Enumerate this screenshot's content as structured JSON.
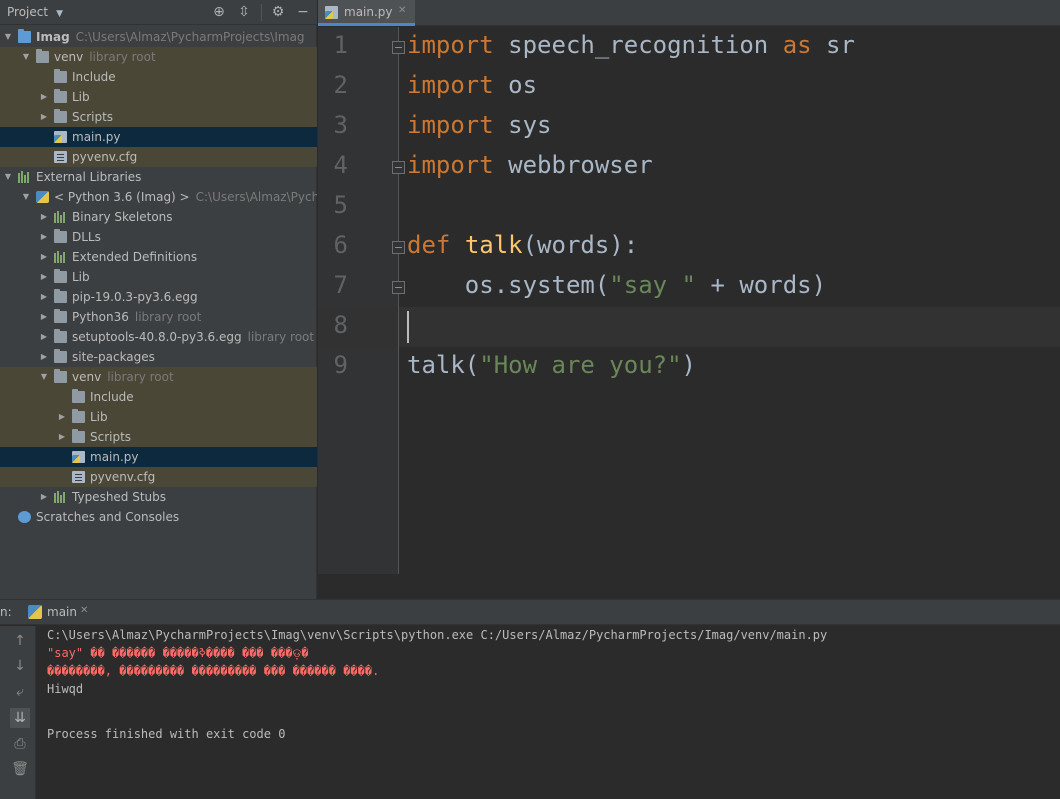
{
  "project_panel": {
    "title": "Project",
    "toolbar_icons": [
      "locate-icon",
      "collapse-icon",
      "gear-icon",
      "hide-icon"
    ],
    "tree": [
      {
        "label": "Imag",
        "hint": "C:\\Users\\Almaz\\PycharmProjects\\Imag",
        "icon": "folder-icon",
        "expanded": true
      },
      {
        "label": "venv",
        "hint": "library root",
        "icon": "folder-icon",
        "expanded": true
      },
      {
        "label": "Include",
        "icon": "folder-icon"
      },
      {
        "label": "Lib",
        "icon": "folder-icon",
        "expanded": false
      },
      {
        "label": "Scripts",
        "icon": "folder-icon",
        "expanded": false
      },
      {
        "label": "main.py",
        "icon": "python-file-icon",
        "selected": true
      },
      {
        "label": "pyvenv.cfg",
        "icon": "config-file-icon"
      },
      {
        "label": "External Libraries",
        "icon": "libraries-icon",
        "expanded": true
      },
      {
        "label": "< Python 3.6 (Imag) >",
        "hint": "C:\\Users\\Almaz\\PycharmProje",
        "icon": "python-icon",
        "expanded": true
      },
      {
        "label": "Binary Skeletons",
        "icon": "libraries-icon",
        "expanded": false
      },
      {
        "label": "DLLs",
        "icon": "folder-icon",
        "expanded": false
      },
      {
        "label": "Extended Definitions",
        "icon": "libraries-icon",
        "expanded": false
      },
      {
        "label": "Lib",
        "icon": "folder-icon",
        "expanded": false
      },
      {
        "label": "pip-19.0.3-py3.6.egg",
        "icon": "folder-icon",
        "expanded": false
      },
      {
        "label": "Python36",
        "hint": "library root",
        "icon": "folder-icon",
        "expanded": false
      },
      {
        "label": "setuptools-40.8.0-py3.6.egg",
        "hint": "library root",
        "icon": "folder-icon",
        "expanded": false
      },
      {
        "label": "site-packages",
        "icon": "folder-icon",
        "expanded": false
      },
      {
        "label": "venv",
        "hint": "library root",
        "icon": "folder-icon",
        "expanded": true
      },
      {
        "label": "Include",
        "icon": "folder-icon"
      },
      {
        "label": "Lib",
        "icon": "folder-icon",
        "expanded": false
      },
      {
        "label": "Scripts",
        "icon": "folder-icon",
        "expanded": false
      },
      {
        "label": "main.py",
        "icon": "python-file-icon",
        "selected": true
      },
      {
        "label": "pyvenv.cfg",
        "icon": "config-file-icon"
      },
      {
        "label": "Typeshed Stubs",
        "icon": "libraries-icon",
        "expanded": false
      },
      {
        "label": "Scratches and Consoles",
        "icon": "scratches-icon"
      }
    ]
  },
  "editor": {
    "tab_label": "main.py",
    "line_numbers": [
      "1",
      "2",
      "3",
      "4",
      "5",
      "6",
      "7",
      "8",
      "9"
    ],
    "code": {
      "l1_kw": "import",
      "l1_mod": " speech_recognition ",
      "l1_as": "as",
      "l1_alias": " sr",
      "l2_kw": "import",
      "l2_mod": " os",
      "l3_kw": "import",
      "l3_mod": " sys",
      "l4_kw": "import",
      "l4_mod": " webbrowser",
      "l6_kw": "def",
      "l6_fn": "talk",
      "l6_rest": "(words):",
      "l7_call": "    os.system(",
      "l7_str": "\"say \"",
      "l7_rest": " + words)",
      "l9_call": "talk(",
      "l9_str": "\"How are you?\"",
      "l9_rest": ")"
    }
  },
  "run_panel": {
    "prefix": "n:",
    "tab_label": "main",
    "console": [
      {
        "text": "C:\\Users\\Almaz\\PycharmProjects\\Imag\\venv\\Scripts\\python.exe C:/Users/Almaz/PycharmProjects/Imag/venv/main.py",
        "error": false
      },
      {
        "text": "\"say\" �� ������ �����ߢ���� ��� ���ଡ଼�",
        "error": true
      },
      {
        "text": "��������, ��������� ��������� ��� ������ ����.",
        "error": true
      },
      {
        "text": "Hiwqd",
        "error": false
      },
      {
        "text": "",
        "error": false
      },
      {
        "text": "Process finished with exit code 0",
        "error": false
      }
    ]
  },
  "colors": {
    "keyword": "#cc7832",
    "function": "#ffc66d",
    "string": "#6a8759",
    "error": "#ff6b68",
    "library_bg": "#4b4736",
    "selection_bg": "#0d293e"
  }
}
